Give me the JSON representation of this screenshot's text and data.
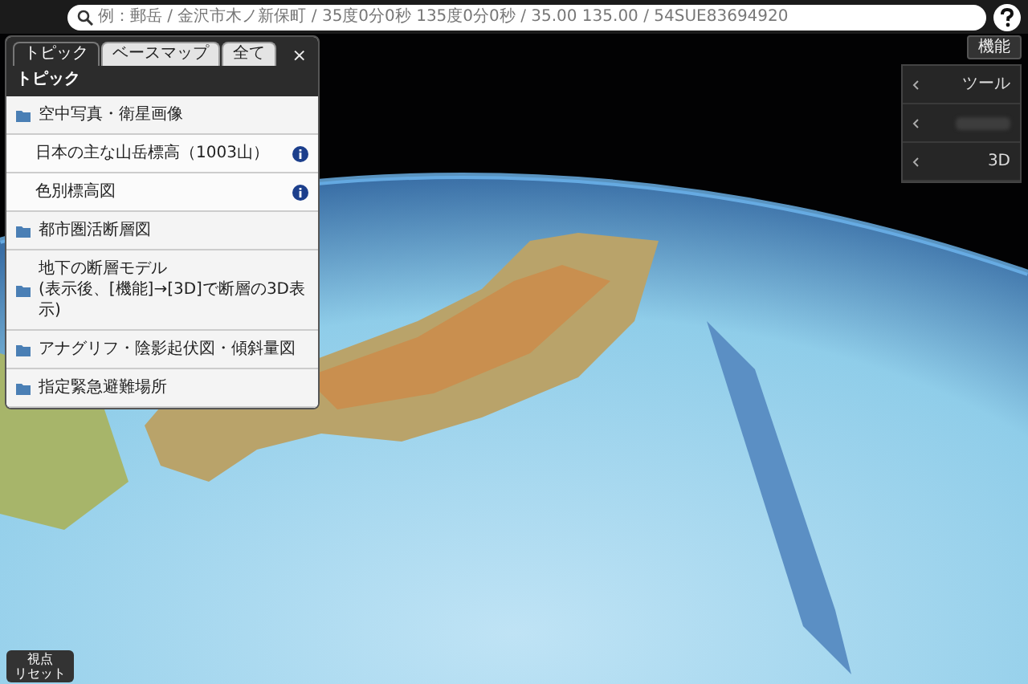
{
  "search": {
    "placeholder": "例：郵岳 / 金沢市木ノ新保町 / 35度0分0秒 135度0分0秒 / 35.00 135.00 / 54SUE83694920"
  },
  "layer_panel": {
    "tabs": [
      {
        "label": "トピック",
        "selected": true
      },
      {
        "label": "ベースマップ",
        "selected": false
      },
      {
        "label": "全て",
        "selected": false
      }
    ],
    "close": "×",
    "heading": "トピック",
    "items": [
      {
        "kind": "folder",
        "label": "空中写真・衛星画像"
      },
      {
        "kind": "layer",
        "label": "日本の主な山岳標高（1003山）"
      },
      {
        "kind": "layer",
        "label": "色別標高図"
      },
      {
        "kind": "folder",
        "label": "都市圏活断層図"
      },
      {
        "kind": "folder",
        "label": "地下の断層モデル\n(表示後、[機能]→[3D]で断層の3D表示)"
      },
      {
        "kind": "folder",
        "label": "アナグリフ・陰影起伏図・傾斜量図"
      },
      {
        "kind": "folder",
        "label": "指定緊急避難場所"
      }
    ]
  },
  "function_button": "機能",
  "function_menu": [
    {
      "label": "ツール"
    },
    {
      "blurred": true
    },
    {
      "label": "3D"
    }
  ],
  "reset_button": [
    "視点",
    "リセット"
  ]
}
